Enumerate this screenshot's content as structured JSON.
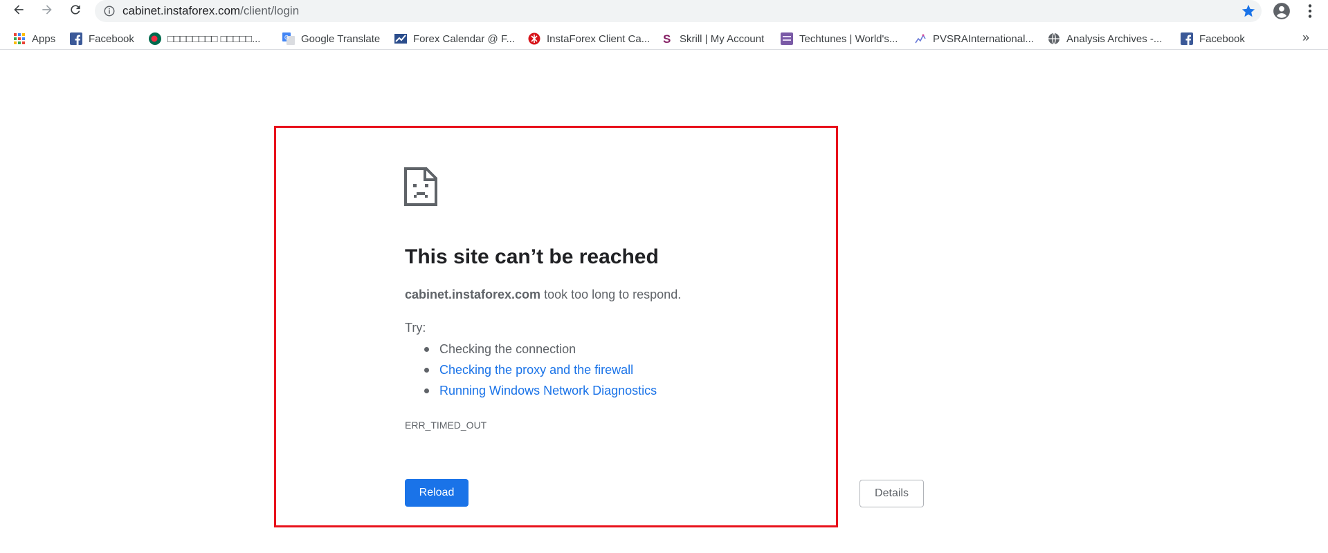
{
  "browser": {
    "url_host": "cabinet.instaforex.com",
    "url_path": "/client/login",
    "colors": {
      "accent": "#1a73e8",
      "star": "#1a73e8",
      "highlight_frame": "#e8111b"
    },
    "icons": {
      "back": "arrow-left-icon",
      "forward": "arrow-right-icon",
      "reload": "reload-icon",
      "site_info": "info-icon",
      "bookmark_star": "star-icon",
      "profile": "account-circle-icon",
      "menu": "vertical-dots-icon"
    }
  },
  "bookmarks": {
    "items": [
      {
        "label": "Apps",
        "icon": "apps-grid-icon"
      },
      {
        "label": "Facebook",
        "icon": "facebook-icon"
      },
      {
        "label": "□□□□□□□□ □□□□□...",
        "icon": "bangladesh-flag-icon"
      },
      {
        "label": "Google Translate",
        "icon": "google-translate-icon"
      },
      {
        "label": "Forex Calendar @ F...",
        "icon": "forex-calendar-icon"
      },
      {
        "label": "InstaForex Client Ca...",
        "icon": "instaforex-icon"
      },
      {
        "label": "Skrill | My Account",
        "icon": "skrill-icon"
      },
      {
        "label": "Techtunes | World's...",
        "icon": "techtunes-icon"
      },
      {
        "label": "PVSRAInternational...",
        "icon": "pvsra-icon"
      },
      {
        "label": "Analysis Archives -...",
        "icon": "globe-icon"
      },
      {
        "label": "Facebook",
        "icon": "facebook-icon"
      }
    ],
    "overflow": "»"
  },
  "error_page": {
    "icon": "sad-document-icon",
    "heading": "This site can’t be reached",
    "host": "cabinet.instaforex.com",
    "message": " took too long to respond.",
    "try_label": "Try:",
    "suggestions": [
      "Checking the connection",
      "Checking the proxy and the firewall",
      "Running Windows Network Diagnostics"
    ],
    "error_code": "ERR_TIMED_OUT",
    "reload_label": "Reload",
    "details_label": "Details"
  }
}
